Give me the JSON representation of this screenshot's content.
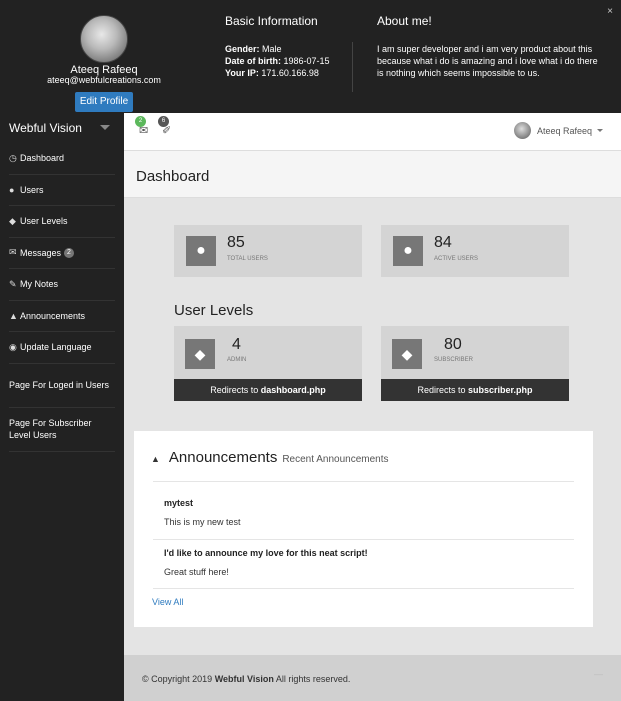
{
  "profile": {
    "name": "Ateeq Rafeeq",
    "email": "ateeq@webfulcreations.com",
    "edit_label": "Edit Profile"
  },
  "basic_info": {
    "title": "Basic Information",
    "gender_label": "Gender:",
    "gender": "Male",
    "dob_label": "Date of birth:",
    "dob": "1986-07-15",
    "ip_label": "Your IP:",
    "ip": "171.60.166.98"
  },
  "about": {
    "title": "About me!",
    "text": "I am super developer and i am very product about this because what i do is amazing and i love what i do there is nothing which seems impossible to us."
  },
  "close_glyph": "×",
  "sidebar": {
    "brand": "Webful Vision",
    "items": [
      {
        "label": "Dashboard",
        "icon": "dashboard-icon",
        "glyph": "◷"
      },
      {
        "label": "Users",
        "icon": "user-icon",
        "glyph": "👤"
      },
      {
        "label": "User Levels",
        "icon": "tag-icon",
        "glyph": "🏷"
      },
      {
        "label": "Messages",
        "icon": "envelope-icon",
        "glyph": "✉",
        "badge": "2"
      },
      {
        "label": "My Notes",
        "icon": "pin-icon",
        "glyph": "✎"
      },
      {
        "label": "Announcements",
        "icon": "bullhorn-icon",
        "glyph": "📢"
      },
      {
        "label": "Update Language",
        "icon": "globe-icon",
        "glyph": "🌐"
      },
      {
        "label": "Page For Loged in Users"
      },
      {
        "label": "Page For Subscriber Level Users"
      }
    ]
  },
  "header": {
    "messages_badge": "2",
    "notes_badge": "6",
    "user_name": "Ateeq Rafeeq"
  },
  "page_title": "Dashboard",
  "stats": [
    {
      "value": "85",
      "label": "TOTAL USERS"
    },
    {
      "value": "84",
      "label": "ACTIVE USERS"
    }
  ],
  "levels_title": "User Levels",
  "levels": [
    {
      "value": "4",
      "label": "ADMIN",
      "link_prefix": "Redirects to",
      "link_page": "dashboard.php"
    },
    {
      "value": "80",
      "label": "SUBSCRIBER",
      "link_prefix": "Redirects to",
      "link_page": "subscriber.php"
    }
  ],
  "announcements": {
    "title": "Announcements",
    "subtitle": "Recent Announcements",
    "items": [
      {
        "title": "mytest",
        "body": "This is my new test"
      },
      {
        "title": "I'd like to announce my love for this neat script!",
        "body": "Great stuff here!"
      }
    ],
    "view_all": "View All"
  },
  "footer": {
    "prefix": "© Copyright 2019",
    "brand": "Webful Vision",
    "suffix": "All rights reserved."
  },
  "colors": {
    "dark": "#222222",
    "accent_blue": "#2f7bbf",
    "badge_green": "#5cb85c",
    "panel_grey": "#d4d4d4"
  }
}
